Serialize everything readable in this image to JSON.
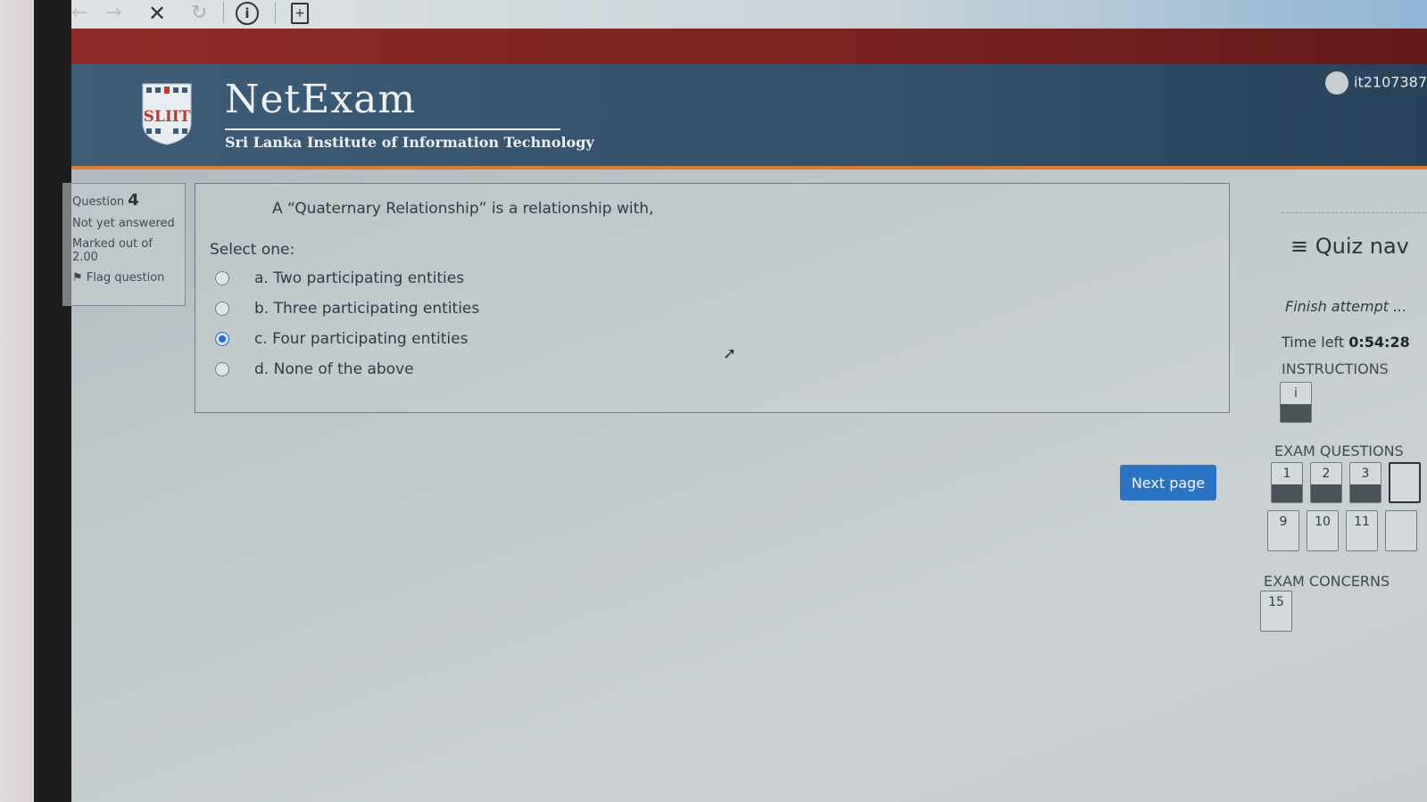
{
  "browser": {
    "back_icon": "←",
    "forward_icon": "→",
    "close_icon": "✕",
    "reload_icon": "↻",
    "info_icon": "i",
    "page_icon": "+"
  },
  "header": {
    "title": "NetExam",
    "subtitle": "Sri Lanka Institute of Information Technology",
    "logo_text": "SLIIT",
    "user": "it2107387"
  },
  "question_info": {
    "label": "Question",
    "number": "4",
    "state": "Not yet answered",
    "marked_out_of": "Marked out of",
    "marks": "2.00",
    "flag_label": "Flag question"
  },
  "question": {
    "text": "A “Quaternary Relationship” is a relationship with,",
    "select_one": "Select one:",
    "options": [
      {
        "label": "a. Two participating entities",
        "selected": false
      },
      {
        "label": "b. Three participating entities",
        "selected": false
      },
      {
        "label": "c. Four participating entities",
        "selected": true
      },
      {
        "label": "d. None of the above",
        "selected": false
      }
    ]
  },
  "next_button": "Next page",
  "quiz_nav": {
    "title": "≡ Quiz nav",
    "finish": "Finish attempt ...",
    "time_label": "Time left",
    "time_value": "0:54:28",
    "instructions_label": "INSTRUCTIONS",
    "instructions_btn": "i",
    "exam_questions_label": "EXAM QUESTIONS",
    "questions_row1": [
      "1",
      "2",
      "3"
    ],
    "questions_row2": [
      "9",
      "10",
      "11"
    ],
    "exam_concerns_label": "EXAM CONCERNS",
    "concerns": [
      "15"
    ]
  }
}
